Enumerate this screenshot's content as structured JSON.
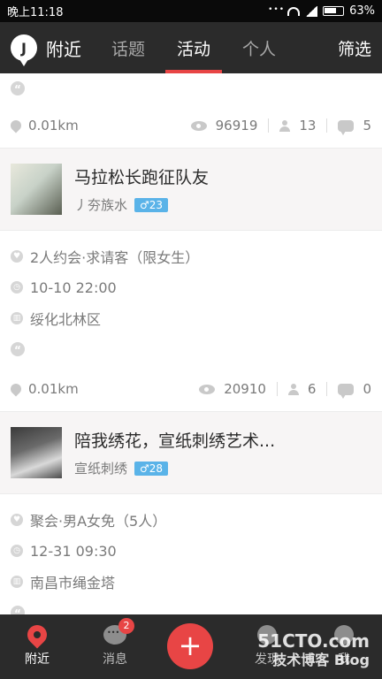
{
  "status_bar": {
    "time": "晚上11:18",
    "battery": "63%"
  },
  "header": {
    "title": "附近",
    "tabs": [
      {
        "label": "话题",
        "active": false
      },
      {
        "label": "活动",
        "active": true
      },
      {
        "label": "个人",
        "active": false
      }
    ],
    "filter_label": "筛选"
  },
  "feed": {
    "top_meta": {
      "distance": "0.01km",
      "views": "96919",
      "participants": "13",
      "comments": "5"
    },
    "events": [
      {
        "title": "马拉松长跑征队友",
        "user": "丿夯族水",
        "badge": "♂23",
        "type": "2人约会·求请客（限女生）",
        "time": "10-10 22:00",
        "place": "绥化北林区",
        "distance": "0.01km",
        "views": "20910",
        "participants": "6",
        "comments": "0"
      },
      {
        "title": "陪我绣花，宣纸刺绣艺术...",
        "user": "宣纸刺绣",
        "badge": "♂28",
        "type": "聚会·男A女免（5人）",
        "time": "12-31 09:30",
        "place": "南昌市绳金塔"
      }
    ]
  },
  "bottom_nav": {
    "nearby": "附近",
    "messages": "消息",
    "message_badge": "2",
    "discover": "发现",
    "me": "我"
  },
  "watermark": {
    "line1": "51CTO.com",
    "line2": "技术博客 Blog"
  },
  "colors": {
    "accent": "#e84545",
    "header_bg": "#2b2b2b",
    "badge_blue": "#5ab3e8"
  }
}
